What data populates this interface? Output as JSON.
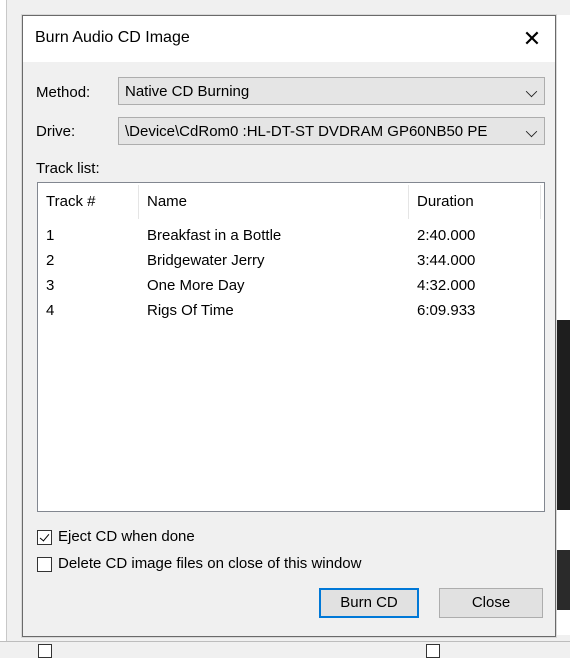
{
  "dialog": {
    "title": "Burn Audio CD Image",
    "close_glyph": "✕"
  },
  "method": {
    "label": "Method:",
    "value": "Native CD Burning"
  },
  "drive": {
    "label": "Drive:",
    "value": "\\Device\\CdRom0 :HL-DT-ST DVDRAM GP60NB50 PE"
  },
  "track_list": {
    "label": "Track list:",
    "columns": [
      "Track #",
      "Name",
      "Duration"
    ],
    "rows": [
      {
        "track": "1",
        "name": "Breakfast in a Bottle",
        "duration": "2:40.000"
      },
      {
        "track": "2",
        "name": "Bridgewater Jerry",
        "duration": "3:44.000"
      },
      {
        "track": "3",
        "name": "One More Day",
        "duration": "4:32.000"
      },
      {
        "track": "4",
        "name": "Rigs Of Time",
        "duration": "6:09.933"
      }
    ]
  },
  "options": {
    "eject": {
      "label": "Eject CD when done",
      "checked": true
    },
    "delete": {
      "label": "Delete CD image files on close of this window",
      "checked": false
    }
  },
  "buttons": {
    "burn": "Burn CD",
    "close": "Close"
  },
  "colors": {
    "accent": "#0078d7"
  }
}
